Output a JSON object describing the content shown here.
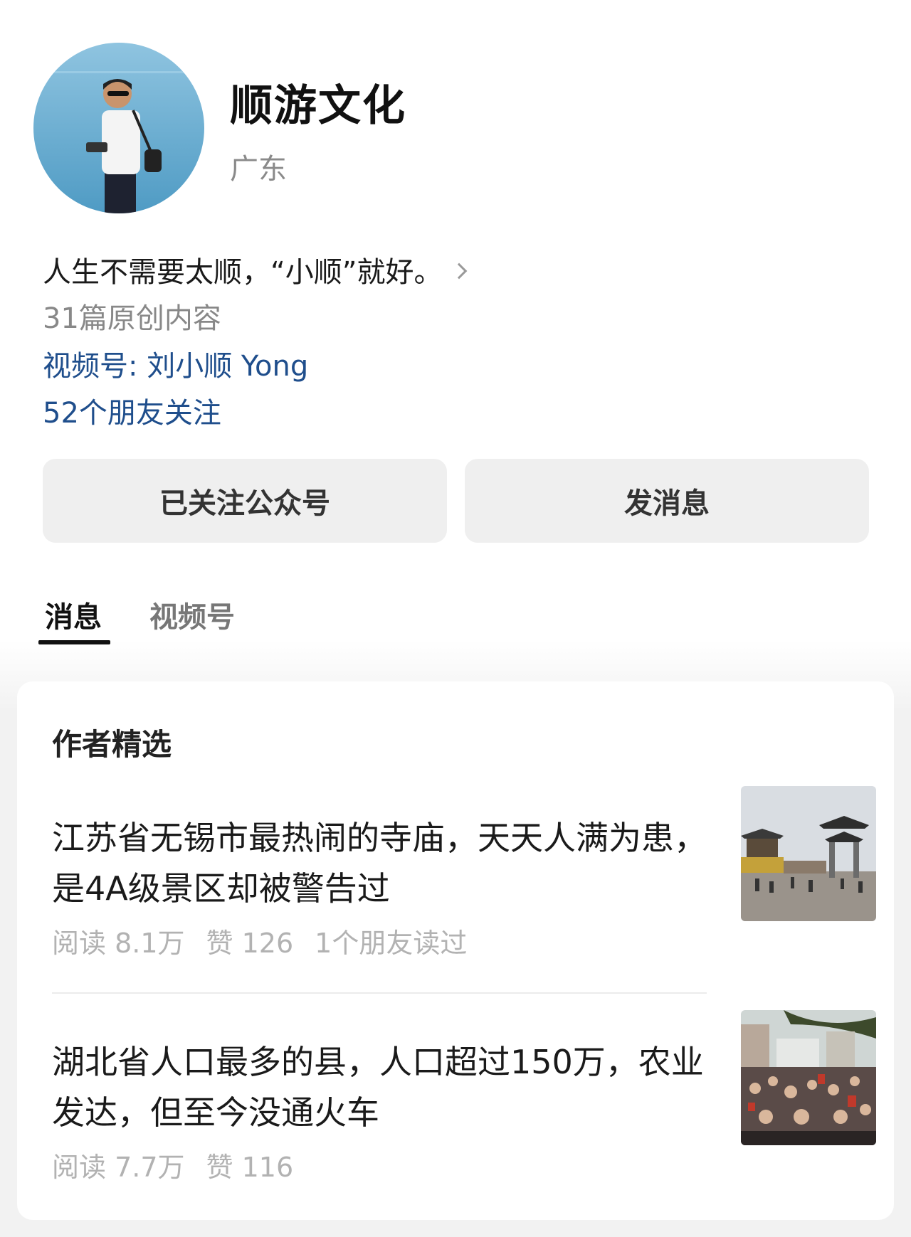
{
  "profile": {
    "name": "顺游文化",
    "region": "广东",
    "bio": "人生不需要太顺，“小顺”就好。",
    "original_count": "31篇原创内容",
    "channels": "视频号: 刘小顺 Yong",
    "friends_following": "52个朋友关注"
  },
  "actions": {
    "follow_label": "已关注公众号",
    "message_label": "发消息"
  },
  "tabs": [
    {
      "label": "消息",
      "active": true
    },
    {
      "label": "视频号",
      "active": false
    }
  ],
  "featured": {
    "title": "作者精选",
    "articles": [
      {
        "title": "江苏省无锡市最热闹的寺庙，天天人满为患，是4A级景区却被警告过",
        "reads": "阅读 8.1万",
        "likes": "赞 126",
        "friends": "1个朋友读过",
        "thumb": "temple-photo"
      },
      {
        "title": "湖北省人口最多的县，人口超过150万，农业发达，但至今没通火车",
        "reads": "阅读 7.7万",
        "likes": "赞 116",
        "thumb": "crowd-street-photo"
      }
    ]
  },
  "colors": {
    "link": "#1f4e8c",
    "muted": "#888888",
    "button_bg": "#efefef"
  }
}
